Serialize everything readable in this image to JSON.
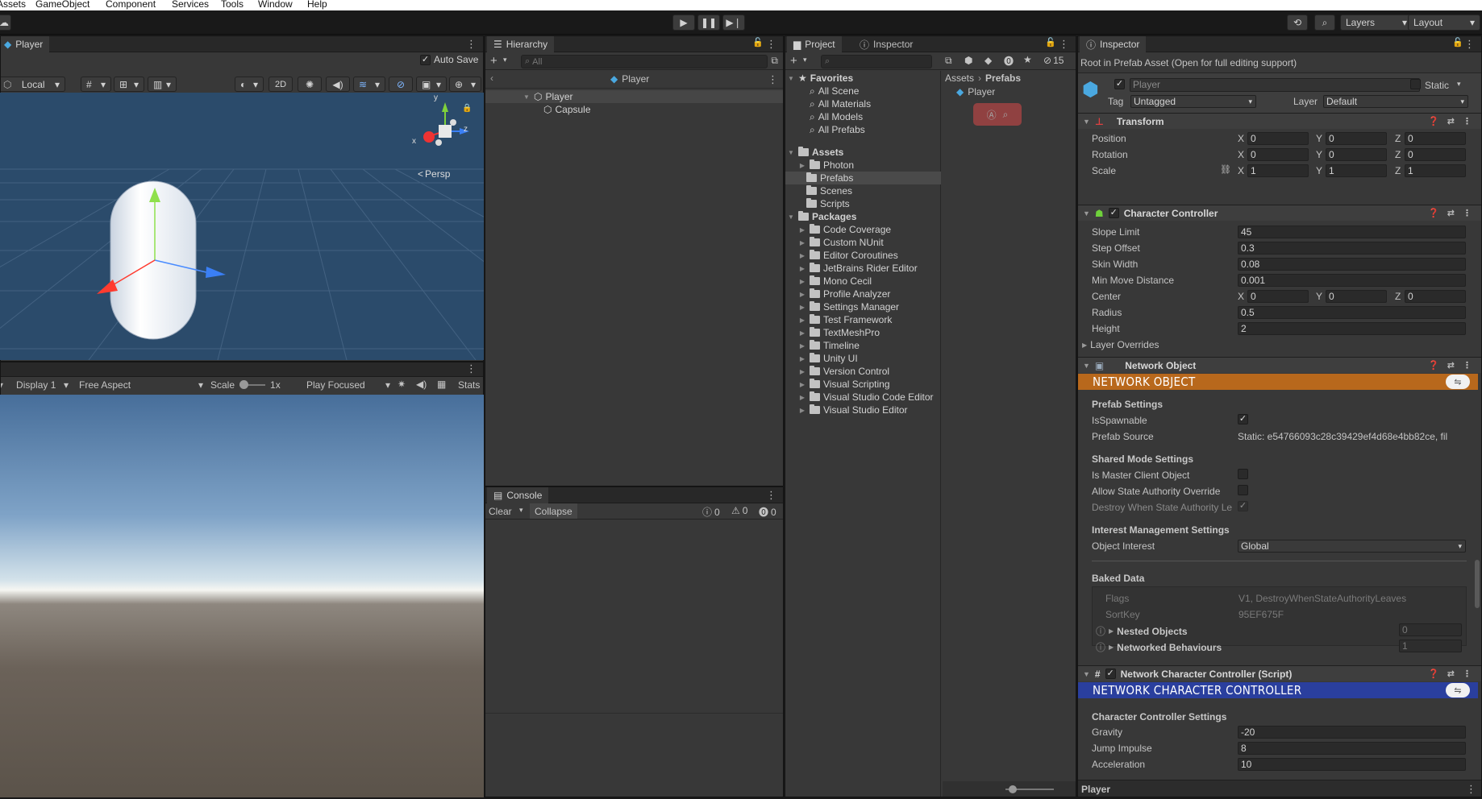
{
  "menu": [
    "Assets",
    "GameObject",
    "Component",
    "Services",
    "Tools",
    "Window",
    "Help"
  ],
  "toolbar": {
    "layers": "Layers",
    "layout": "Layout"
  },
  "scene": {
    "tab": "Player",
    "auto_save": "Auto Save",
    "pivot": "Local",
    "mode_2d": "2D",
    "gizmo_persp": "Persp",
    "gizmo_y": "y",
    "gizmo_x": "x",
    "gizmo_z": "z"
  },
  "game": {
    "display": "Display 1",
    "aspect": "Free Aspect",
    "scale_label": "Scale",
    "scale_value": "1x",
    "play_mode": "Play Focused",
    "stats": "Stats"
  },
  "hierarchy": {
    "tab": "Hierarchy",
    "search_placeholder": "All",
    "prefab_title": "Player",
    "items": [
      {
        "label": "Player"
      },
      {
        "label": "Capsule"
      }
    ]
  },
  "console": {
    "tab": "Console",
    "clear": "Clear",
    "collapse": "Collapse",
    "log_count": "0",
    "warn_count": "0",
    "error_count": "0"
  },
  "project": {
    "tab_project": "Project",
    "tab_inspector": "Inspector",
    "hidden_count": "15",
    "favorites": {
      "label": "Favorites",
      "items": [
        "All Scene",
        "All Materials",
        "All Models",
        "All Prefabs"
      ]
    },
    "assets": {
      "label": "Assets",
      "items": [
        "Photon",
        "Prefabs",
        "Scenes",
        "Scripts"
      ]
    },
    "packages": {
      "label": "Packages",
      "items": [
        "Code Coverage",
        "Custom NUnit",
        "Editor Coroutines",
        "JetBrains Rider Editor",
        "Mono Cecil",
        "Profile Analyzer",
        "Settings Manager",
        "Test Framework",
        "TextMeshPro",
        "Timeline",
        "Unity UI",
        "Version Control",
        "Visual Scripting",
        "Visual Studio Code Editor",
        "Visual Studio Editor"
      ]
    },
    "breadcrumb": [
      "Assets",
      "Prefabs"
    ],
    "content_item": "Player"
  },
  "inspector": {
    "tab": "Inspector",
    "prefab_note": "Root in Prefab Asset (Open for full editing support)",
    "object_name": "Player",
    "static_label": "Static",
    "tag_label": "Tag",
    "tag_value": "Untagged",
    "layer_label": "Layer",
    "layer_value": "Default",
    "transform": {
      "title": "Transform",
      "position": {
        "label": "Position",
        "x": "0",
        "y": "0",
        "z": "0"
      },
      "rotation": {
        "label": "Rotation",
        "x": "0",
        "y": "0",
        "z": "0"
      },
      "scale": {
        "label": "Scale",
        "x": "1",
        "y": "1",
        "z": "1"
      }
    },
    "character_controller": {
      "title": "Character Controller",
      "slope_limit": {
        "label": "Slope Limit",
        "value": "45"
      },
      "step_offset": {
        "label": "Step Offset",
        "value": "0.3"
      },
      "skin_width": {
        "label": "Skin Width",
        "value": "0.08"
      },
      "min_move": {
        "label": "Min Move Distance",
        "value": "0.001"
      },
      "center": {
        "label": "Center",
        "x": "0",
        "y": "0",
        "z": "0"
      },
      "radius": {
        "label": "Radius",
        "value": "0.5"
      },
      "height": {
        "label": "Height",
        "value": "2"
      },
      "layer_overrides": "Layer Overrides"
    },
    "network_object": {
      "title": "Network Object",
      "banner": "NETWORK OBJECT",
      "prefab_settings": "Prefab Settings",
      "is_spawnable": "IsSpawnable",
      "prefab_source_label": "Prefab Source",
      "prefab_source_value": "Static: e54766093c28c39429ef4d68e4bb82ce, fil",
      "shared_mode": "Shared Mode Settings",
      "is_master_client": "Is Master Client Object",
      "allow_state_authority": "Allow State Authority Override",
      "destroy_when": "Destroy When State Authority Le",
      "interest_settings": "Interest Management Settings",
      "object_interest_label": "Object Interest",
      "object_interest_value": "Global",
      "baked_data": "Baked Data",
      "flags_label": "Flags",
      "flags_value": "V1, DestroyWhenStateAuthorityLeaves",
      "sortkey_label": "SortKey",
      "sortkey_value": "95EF675F",
      "nested_objects_label": "Nested Objects",
      "nested_objects_value": "0",
      "networked_behaviours_label": "Networked Behaviours",
      "networked_behaviours_value": "1"
    },
    "network_cc": {
      "title": "Network Character Controller (Script)",
      "banner": "NETWORK CHARACTER CONTROLLER",
      "settings": "Character Controller Settings",
      "gravity": {
        "label": "Gravity",
        "value": "-20"
      },
      "jump": {
        "label": "Jump Impulse",
        "value": "8"
      },
      "accel": {
        "label": "Acceleration",
        "value": "10"
      }
    },
    "footer": "Player"
  },
  "colors": {
    "network_object_banner": "#b8681c",
    "network_cc_banner": "#2a3f9e",
    "scene_bg": "#2b4b6b"
  }
}
